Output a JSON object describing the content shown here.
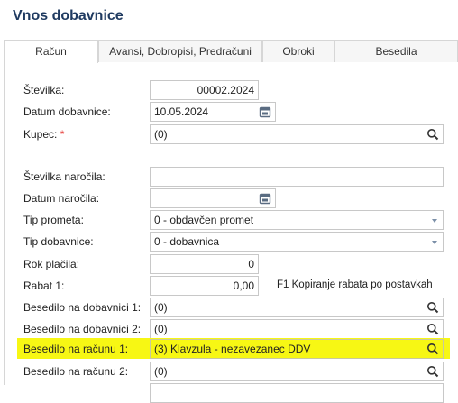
{
  "page": {
    "title": "Vnos dobavnice"
  },
  "tabs": [
    {
      "label": "Račun",
      "active": true
    },
    {
      "label": "Avansi, Dobropisi, Predračuni",
      "active": false
    },
    {
      "label": "Obroki",
      "active": false
    },
    {
      "label": "Besedila",
      "active": false
    }
  ],
  "form": {
    "stevilka": {
      "label": "Številka:",
      "value": "00002.2024"
    },
    "datum_dobavnice": {
      "label": "Datum dobavnice:",
      "value": "10.05.2024",
      "icon": "calendar-icon"
    },
    "kupec": {
      "label": "Kupec:",
      "required_mark": "*",
      "value": "(0)",
      "icon": "search-icon"
    },
    "stevilka_narocila": {
      "label": "Številka naročila:",
      "value": ""
    },
    "datum_narocila": {
      "label": "Datum naročila:",
      "value": "",
      "icon": "calendar-icon"
    },
    "tip_prometa": {
      "label": "Tip prometa:",
      "value": "0 - obdavčen promet"
    },
    "tip_dobavnice": {
      "label": "Tip dobavnice:",
      "value": "0 - dobavnica"
    },
    "rok_placila": {
      "label": "Rok plačila:",
      "value": "0"
    },
    "rabat": {
      "label": "Rabat 1:",
      "value": "0,00",
      "hint": "F1 Kopiranje rabata po postavkah"
    },
    "besedilo_dob_1": {
      "label": "Besedilo na dobavnici 1:",
      "value": "(0)"
    },
    "besedilo_dob_2": {
      "label": "Besedilo na dobavnici 2:",
      "value": "(0)"
    },
    "besedilo_rac_1": {
      "label": "Besedilo na računu 1:",
      "value": "(3) Klavzula - nezavezanec DDV",
      "highlighted": true
    },
    "besedilo_rac_2": {
      "label": "Besedilo na računu 2:",
      "value": "(0)"
    }
  },
  "colors": {
    "title": "#1f3a60",
    "highlight": "#f7f714",
    "required": "#e53935"
  }
}
